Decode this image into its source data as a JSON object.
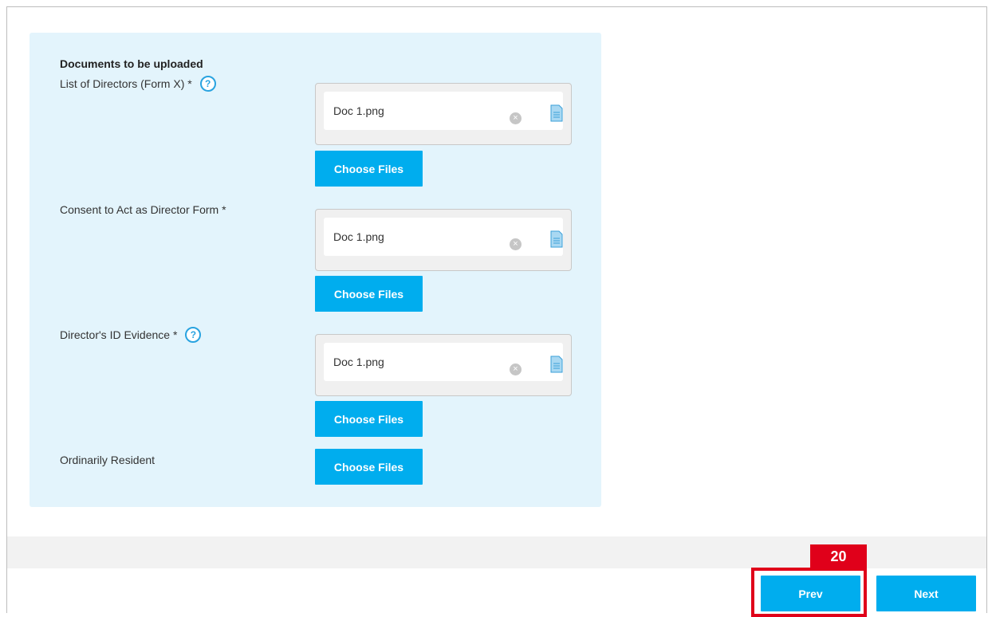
{
  "section": {
    "title": "Documents to be uploaded"
  },
  "fields": [
    {
      "label": "List of Directors (Form X) *",
      "has_help": true,
      "file": "Doc 1.png",
      "button": "Choose Files"
    },
    {
      "label": "Consent to Act as Director Form *",
      "has_help": false,
      "file": "Doc 1.png",
      "button": "Choose Files"
    },
    {
      "label": "Director's ID Evidence *",
      "has_help": true,
      "file": "Doc 1.png",
      "button": "Choose Files"
    },
    {
      "label": "Ordinarily Resident",
      "has_help": false,
      "button": "Choose Files"
    }
  ],
  "icons": {
    "help": "?",
    "remove": "×"
  },
  "nav": {
    "prev_label": "Prev",
    "next_label": "Next"
  },
  "annotation": {
    "step_number": "20",
    "color": "#e0001a"
  },
  "colors": {
    "accent": "#00adee",
    "panel_bg": "#e3f4fc"
  }
}
